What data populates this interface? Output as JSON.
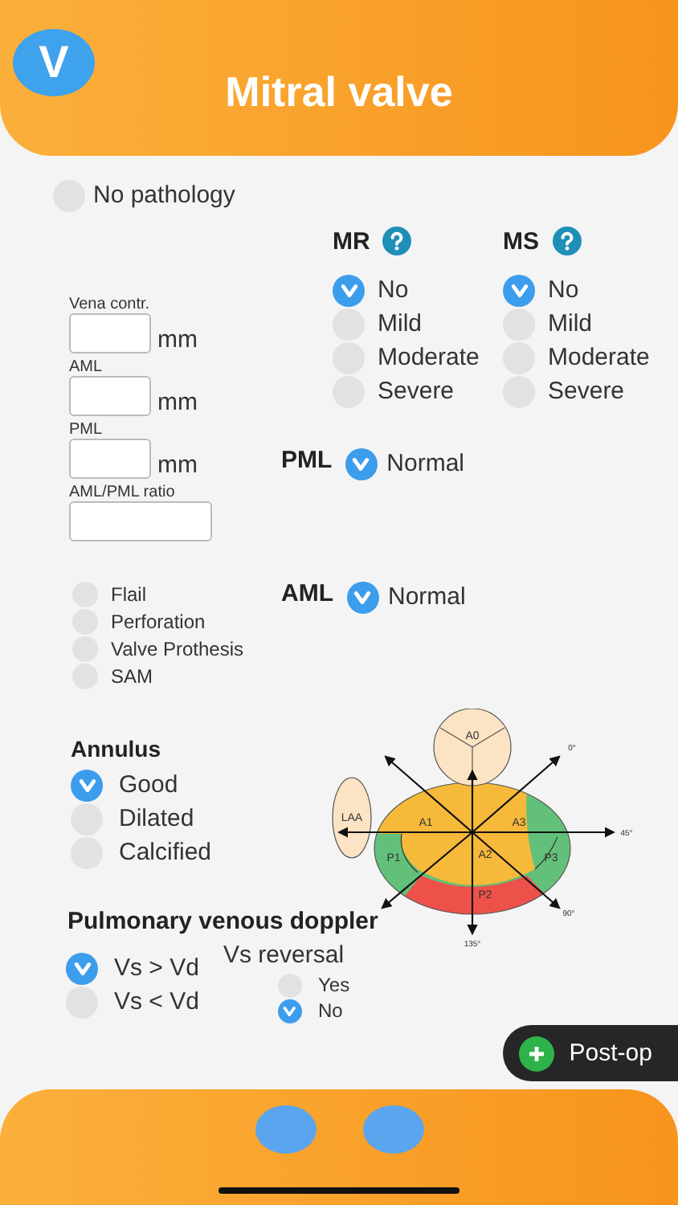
{
  "header": {
    "logo": "V",
    "title": "Mitral valve"
  },
  "no_pathology": {
    "label": "No pathology",
    "checked": false
  },
  "measurements": [
    {
      "label": "Vena contr.",
      "unit": "mm"
    },
    {
      "label": "AML",
      "unit": "mm"
    },
    {
      "label": "PML",
      "unit": "mm"
    },
    {
      "label": "AML/PML ratio"
    }
  ],
  "mr": {
    "title": "MR",
    "options": [
      {
        "label": "No",
        "selected": true
      },
      {
        "label": "Mild",
        "selected": false
      },
      {
        "label": "Moderate",
        "selected": false
      },
      {
        "label": "Severe",
        "selected": false
      }
    ]
  },
  "ms": {
    "title": "MS",
    "options": [
      {
        "label": "No",
        "selected": true
      },
      {
        "label": "Mild",
        "selected": false
      },
      {
        "label": "Moderate",
        "selected": false
      },
      {
        "label": "Severe",
        "selected": false
      }
    ]
  },
  "pml": {
    "title": "PML",
    "option": {
      "label": "Normal",
      "checked": true
    }
  },
  "lesions": [
    {
      "label": "Flail",
      "checked": false
    },
    {
      "label": "Perforation",
      "checked": false
    },
    {
      "label": "Valve Prothesis",
      "checked": false
    },
    {
      "label": "SAM",
      "checked": false
    }
  ],
  "aml": {
    "title": "AML",
    "option": {
      "label": "Normal",
      "checked": true
    }
  },
  "annulus": {
    "title": "Annulus",
    "options": [
      {
        "label": "Good",
        "selected": true
      },
      {
        "label": "Dilated",
        "selected": false
      },
      {
        "label": "Calcified",
        "selected": false
      }
    ]
  },
  "diagram": {
    "segments": [
      "A0",
      "LAA",
      "A1",
      "A2",
      "A3",
      "P1",
      "P2",
      "P3"
    ],
    "angles": [
      "0°",
      "45°",
      "90°",
      "135°"
    ]
  },
  "pulmonary_doppler": {
    "title": "Pulmonary venous doppler",
    "options": [
      {
        "label": "Vs > Vd",
        "selected": true
      },
      {
        "label": "Vs < Vd",
        "selected": false
      }
    ],
    "reversal": {
      "title": "Vs reversal",
      "options": [
        {
          "label": "Yes",
          "selected": false
        },
        {
          "label": "No",
          "selected": true
        }
      ]
    }
  },
  "post_op_button": {
    "label": "Post-op"
  }
}
